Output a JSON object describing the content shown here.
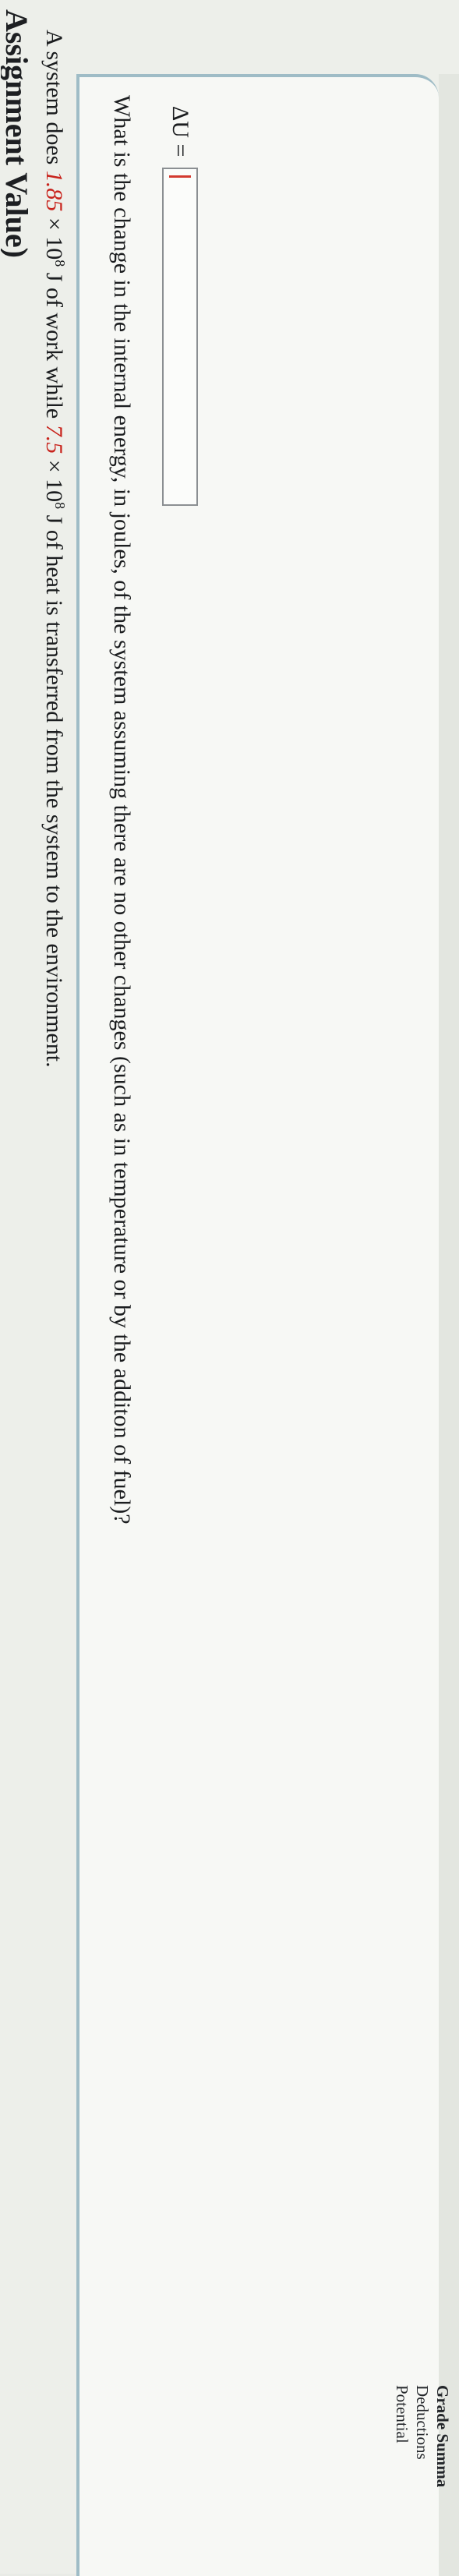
{
  "header": {
    "cut_title": "Assignment Value)"
  },
  "question": {
    "prefix": "A system does ",
    "work_value": "1.85",
    "times1": " × 10",
    "exp1": "8",
    "mid": " J of work while ",
    "heat_value": "7.5",
    "times2": " × 10",
    "exp2": "8",
    "suffix": " J of heat is transferred from the system to the environment."
  },
  "sub_question": "What is the change in the internal energy, in joules, of the system assuming there are no other changes (such as in temperature or by the additon of fuel)?",
  "answer": {
    "label": "ΔU =",
    "value": ""
  },
  "grade_summary": {
    "title": "Grade Summa",
    "deductions": "Deductions",
    "potential": "Potential"
  },
  "colors": {
    "accent_red": "#c8231c",
    "panel_border": "#9fbcc6"
  }
}
